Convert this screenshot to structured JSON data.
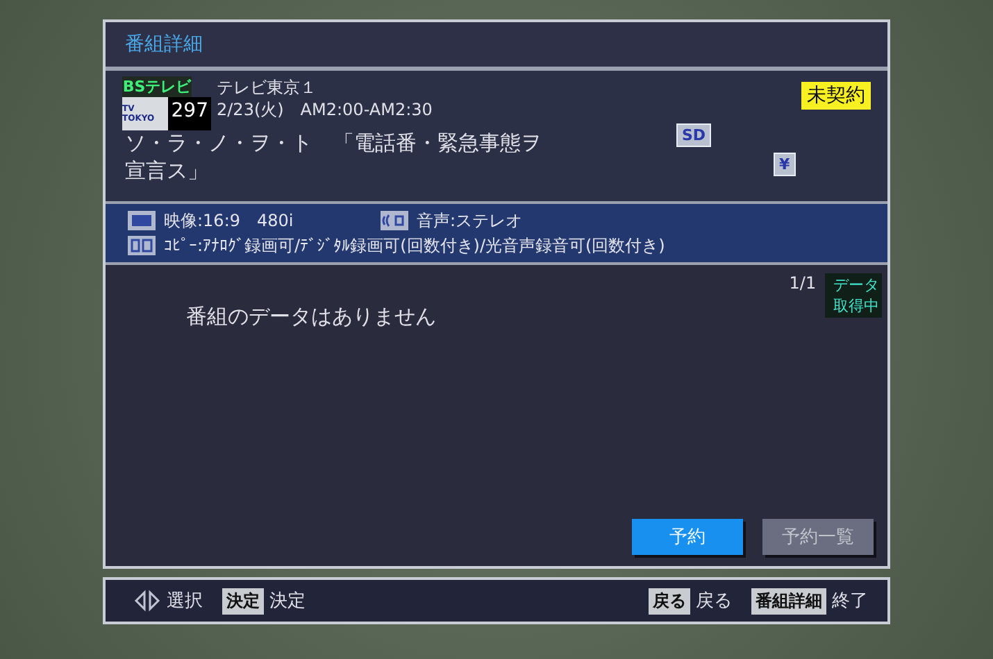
{
  "window": {
    "title": "番組詳細"
  },
  "channel": {
    "network": "BSテレビ",
    "logo": "TV TOKYO",
    "number": "297",
    "name": "テレビ東京１",
    "datetime": "2/23(火)　AM2:00-AM2:30",
    "contract": "未契約"
  },
  "program": {
    "title": "ソ・ラ・ノ・ヲ・ト　「電話番・緊急事態ヲ宣言ス」",
    "badges": [
      "SD",
      "¥"
    ]
  },
  "info": {
    "video": "映像:16:9　480i",
    "audio": "音声:ステレオ",
    "copy": "ｺﾋﾟｰ:ｱﾅﾛｸﾞ録画可/ﾃﾞｼﾞﾀﾙ録画可(回数付き)/光音声録音可(回数付き)"
  },
  "content": {
    "page": "1/1",
    "status": "データ取得中",
    "message": "番組のデータはありません"
  },
  "buttons": [
    {
      "label": "予約",
      "selected": true
    },
    {
      "label": "予約一覧",
      "selected": false
    }
  ],
  "footer": [
    {
      "kind": "arrows",
      "label": "選択"
    },
    {
      "kind": "key",
      "key": "決定",
      "label": "決定"
    },
    {
      "kind": "spacer"
    },
    {
      "kind": "key",
      "key": "戻る",
      "label": "戻る"
    },
    {
      "kind": "key",
      "key": "番組詳細",
      "label": "終了"
    }
  ]
}
